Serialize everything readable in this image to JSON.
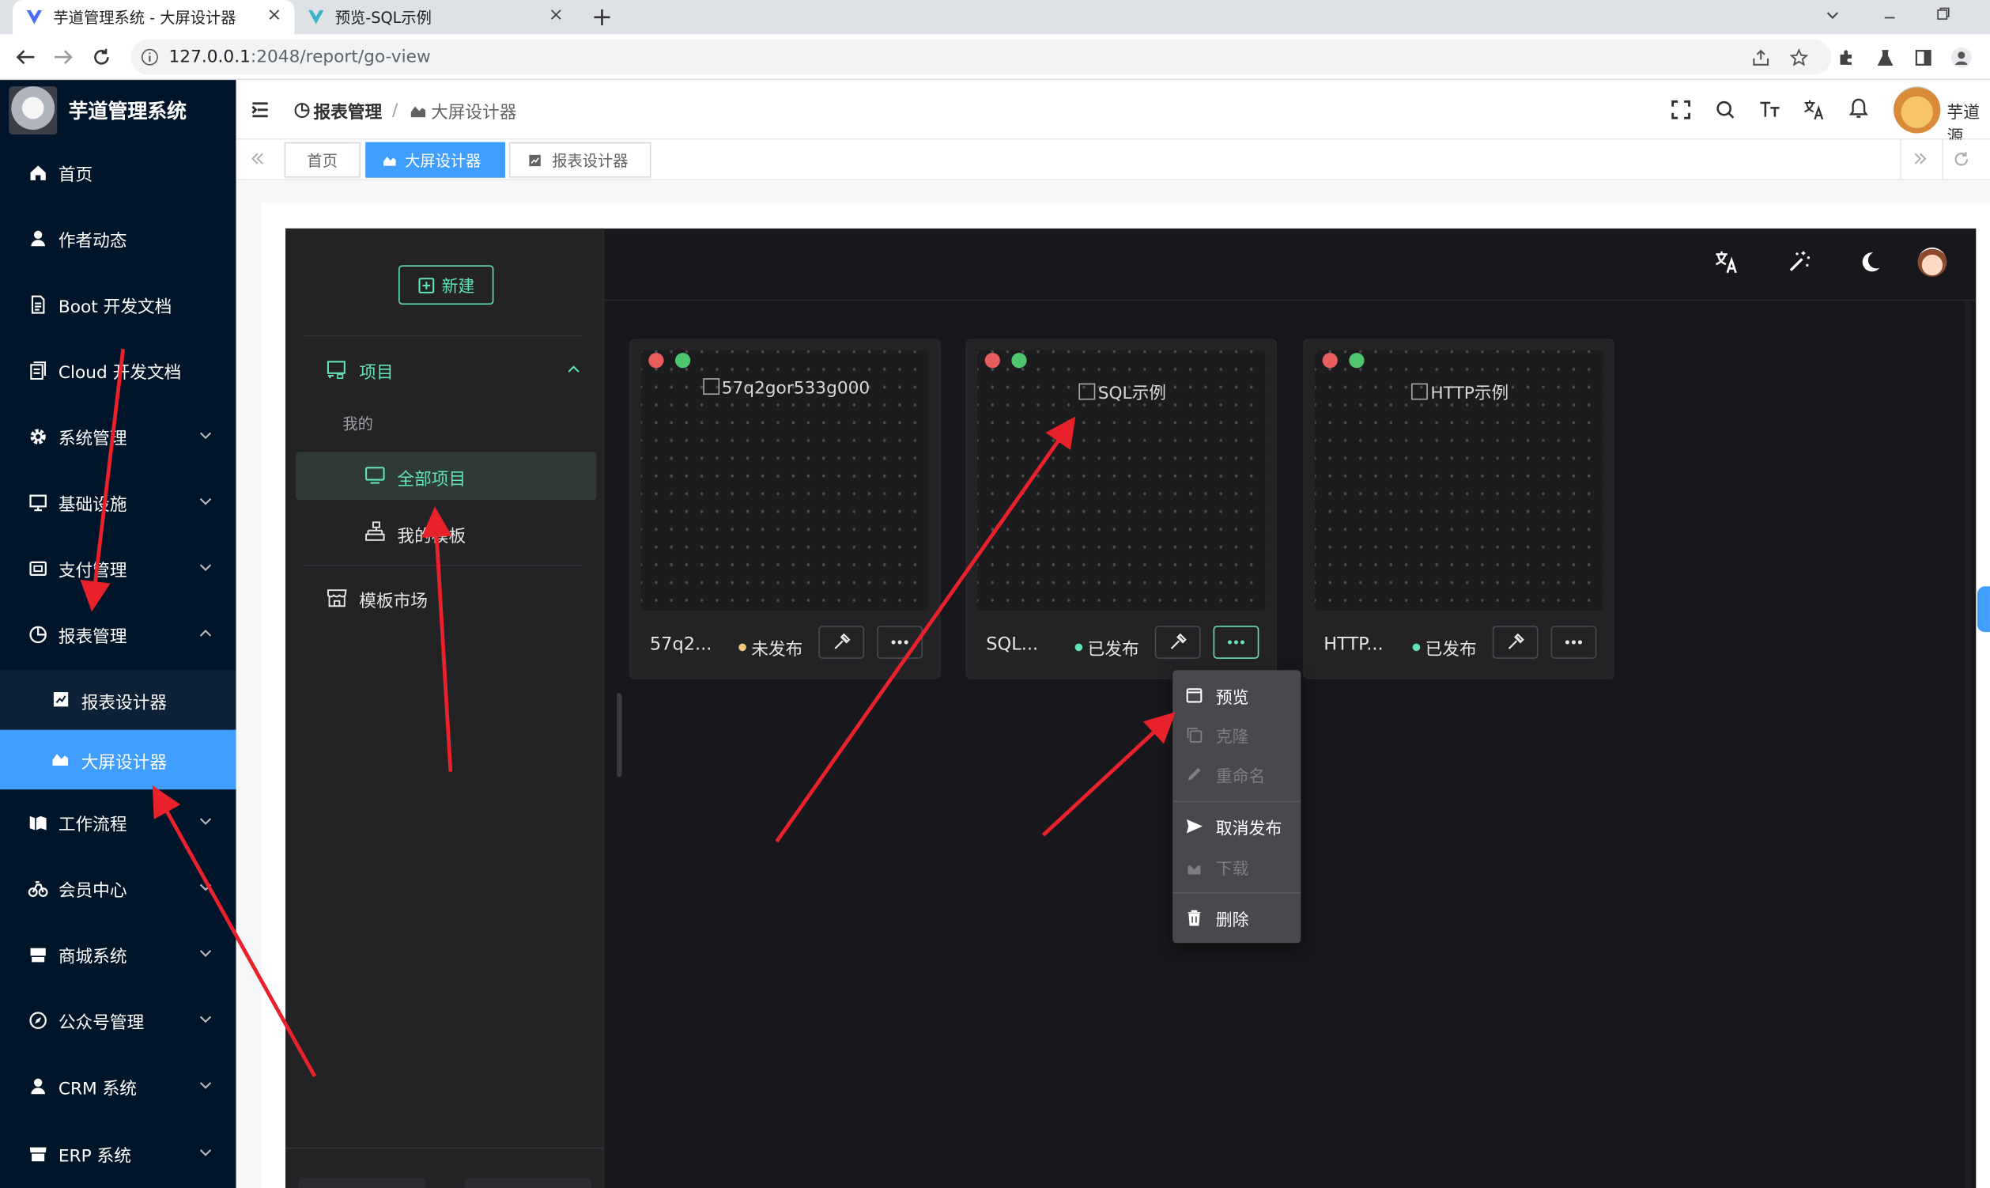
{
  "browser": {
    "tabs": [
      {
        "title": "芋道管理系统 - 大屏设计器",
        "active": true
      },
      {
        "title": "预览-SQL示例",
        "active": false
      }
    ],
    "new_tab": "+",
    "close": "×",
    "url_host": "127.0.0.1",
    "url_rest": ":2048/report/go-view"
  },
  "sidebar": {
    "title": "芋道管理系统",
    "items": [
      {
        "label": "首页",
        "icon": "home-icon"
      },
      {
        "label": "作者动态",
        "icon": "user-icon"
      },
      {
        "label": "Boot 开发文档",
        "icon": "document-icon"
      },
      {
        "label": "Cloud 开发文档",
        "icon": "documents-icon"
      },
      {
        "label": "系统管理",
        "icon": "gear-icon",
        "expandable": true
      },
      {
        "label": "基础设施",
        "icon": "monitor-icon",
        "expandable": true
      },
      {
        "label": "支付管理",
        "icon": "wallet-icon",
        "expandable": true
      },
      {
        "label": "报表管理",
        "icon": "chart-pie-icon",
        "expanded": true
      },
      {
        "label": "报表设计器",
        "icon": "report-icon",
        "sub": true
      },
      {
        "label": "大屏设计器",
        "icon": "area-chart-icon",
        "sub": true,
        "selected": true
      },
      {
        "label": "工作流程",
        "icon": "workflow-icon",
        "expandable": true
      },
      {
        "label": "会员中心",
        "icon": "member-icon",
        "expandable": true
      },
      {
        "label": "商城系统",
        "icon": "shop-icon",
        "expandable": true
      },
      {
        "label": "公众号管理",
        "icon": "compass-icon",
        "expandable": true
      },
      {
        "label": "CRM 系统",
        "icon": "user-icon",
        "expandable": true
      },
      {
        "label": "ERP 系统",
        "icon": "store-icon",
        "expandable": true
      }
    ]
  },
  "header": {
    "breadcrumb": [
      "报表管理",
      "大屏设计器"
    ],
    "user_name": "芋道源"
  },
  "tags": [
    "首页",
    "大屏设计器",
    "报表设计器"
  ],
  "goview": {
    "new_button": "新建",
    "menu": {
      "project": "项目",
      "mine": "我的",
      "all_projects": "全部项目",
      "my_templates": "我的模板",
      "template_market": "模板市场"
    },
    "cards": [
      {
        "name": "57q2...",
        "image_alt": "57q2gor533g000",
        "status": "未发布",
        "status_color": "#f2c97d"
      },
      {
        "name": "SQL...",
        "image_alt": "SQL示例",
        "status": "已发布",
        "status_color": "#63e2b7"
      },
      {
        "name": "HTTP...",
        "image_alt": "HTTP示例",
        "status": "已发布",
        "status_color": "#63e2b7"
      }
    ],
    "dropdown": [
      {
        "label": "预览",
        "enabled": true
      },
      {
        "label": "克隆",
        "enabled": false
      },
      {
        "label": "重命名",
        "enabled": false
      },
      {
        "label": "取消发布",
        "enabled": true
      },
      {
        "label": "下载",
        "enabled": false
      },
      {
        "label": "删除",
        "enabled": true
      }
    ]
  },
  "colors": {
    "sidebar_bg": "#001529",
    "accent": "#409eff",
    "goview_green": "#63e2b7",
    "annotation_arrow": "#e8212b"
  }
}
